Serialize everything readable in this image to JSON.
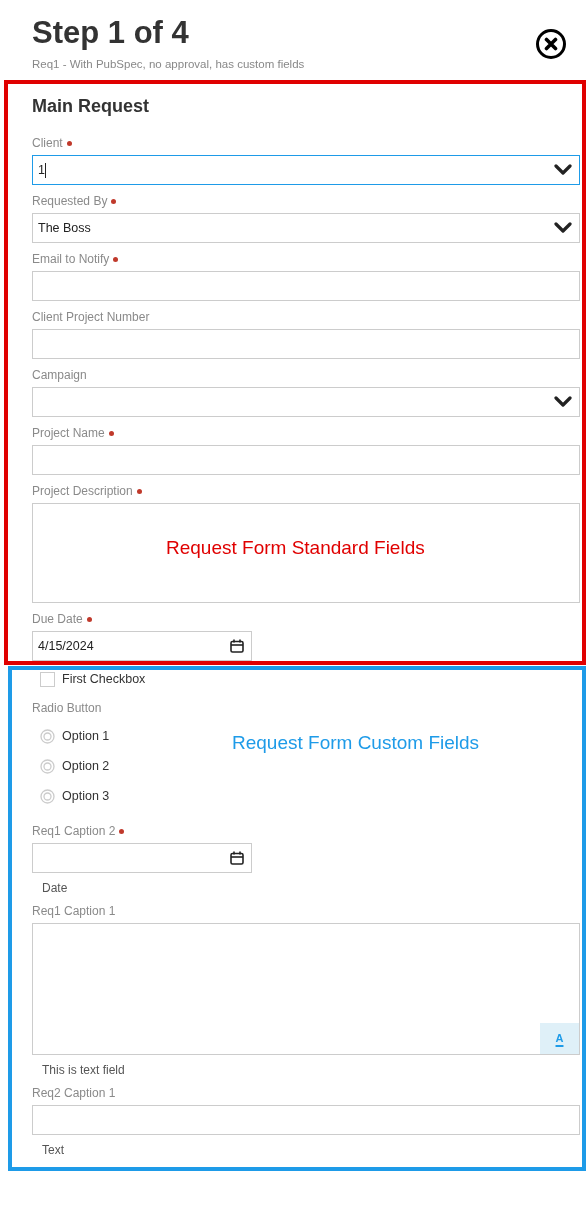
{
  "header": {
    "title": "Step 1 of 4",
    "subtitle": "Req1 - With PubSpec, no approval, has custom fields"
  },
  "standard": {
    "annotation": "Request Form Standard Fields",
    "heading": "Main Request",
    "fields": [
      {
        "kind": "select",
        "label": "Client",
        "required": true,
        "value": "1",
        "focused": true
      },
      {
        "kind": "select",
        "label": "Requested By",
        "required": true,
        "value": "The Boss",
        "focused": false
      },
      {
        "kind": "text",
        "label": "Email to Notify",
        "required": true,
        "focused": false
      },
      {
        "kind": "text",
        "label": "Client Project Number",
        "required": false,
        "focused": false
      },
      {
        "kind": "select",
        "label": "Campaign",
        "required": false,
        "focused": false
      },
      {
        "kind": "text",
        "label": "Project Name",
        "required": true,
        "focused": false
      },
      {
        "kind": "textarea",
        "label": "Project Description",
        "required": true,
        "focused": false
      },
      {
        "kind": "date",
        "label": "Due Date",
        "required": true,
        "value": "4/15/2024",
        "focused": false
      }
    ]
  },
  "custom": {
    "annotation": "Request Form Custom Fields",
    "fields": [
      {
        "kind": "checkbox",
        "label": "First Checkbox",
        "checked": false
      },
      {
        "kind": "radio",
        "label": "Radio Button",
        "options": [
          {
            "label": "Option 1",
            "selected": false
          },
          {
            "label": "Option 2",
            "selected": false
          },
          {
            "label": "Option 3",
            "selected": false
          }
        ]
      },
      {
        "kind": "date",
        "label": "Req1 Caption 2",
        "required": true,
        "help": "Date"
      },
      {
        "kind": "textarea",
        "label": "Req1 Caption 1",
        "required": false,
        "help": "This is text field",
        "format_button": "A"
      },
      {
        "kind": "text",
        "label": "Req2 Caption 1",
        "required": false,
        "help": "Text"
      }
    ]
  }
}
